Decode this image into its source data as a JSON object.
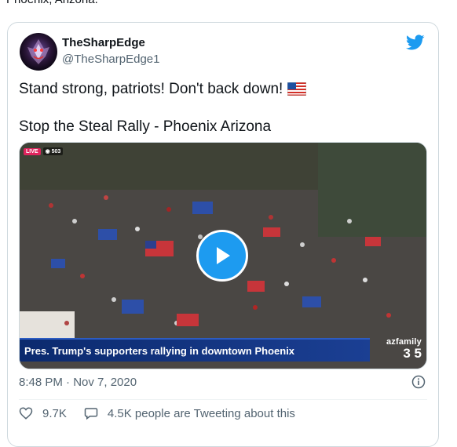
{
  "context": {
    "top_text": "Phoenix, Arizona."
  },
  "author": {
    "display_name": "TheSharpEdge",
    "handle": "@TheSharpEdge1",
    "avatar_icon": "avatar-icon"
  },
  "brand": {
    "logo_icon": "twitter-bird-icon",
    "color": "#1d9bf0"
  },
  "tweet": {
    "line1": "Stand strong, patriots! Don't back down!",
    "line1_emoji": "us-flag-emoji",
    "line2": "Stop the Steal Rally - Phoenix Arizona"
  },
  "media": {
    "live_label": "LIVE",
    "viewer_count": "503",
    "caption": "Pres. Trump's supporters rallying in downtown Phoenix",
    "station_name": "azfamily",
    "station_channels": "3 5",
    "play_icon": "play-icon"
  },
  "meta": {
    "timestamp": "8:48 PM · Nov 7, 2020",
    "info_icon": "info-icon"
  },
  "actions": {
    "likes": "9.7K",
    "conversation": "4.5K people are Tweeting about this"
  },
  "colors": {
    "text": "#0f1419",
    "muted": "#536471",
    "border": "#cfd9de",
    "accent": "#1d9bf0"
  }
}
